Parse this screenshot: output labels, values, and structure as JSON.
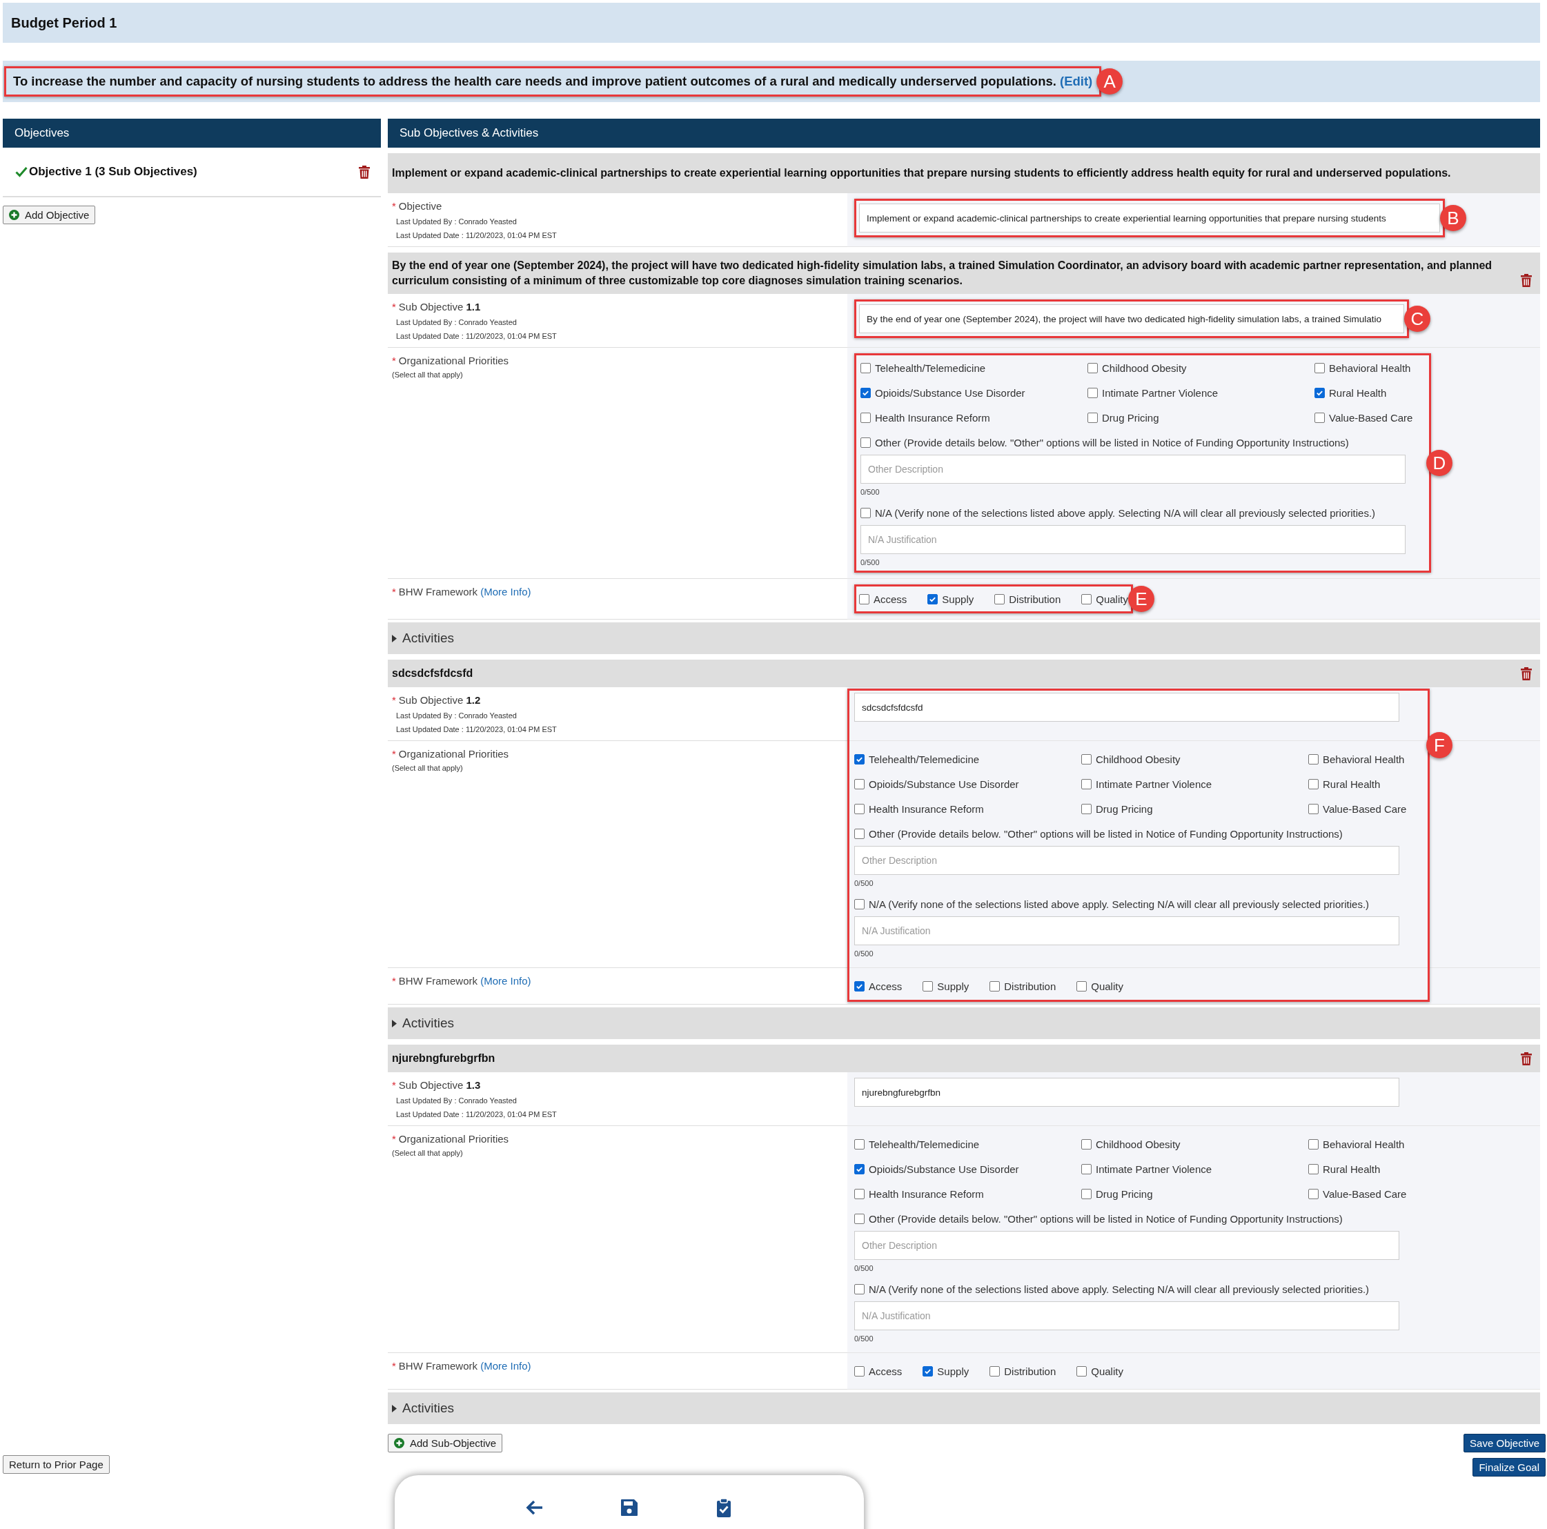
{
  "header": {
    "title": "Budget Period 1"
  },
  "goal": {
    "text": "To increase the number and capacity of nursing students to address the health care needs and improve patient outcomes of a rural and medically underserved populations.",
    "edit_link": "(Edit)",
    "annotation": "A"
  },
  "column_headers": [
    "Objectives",
    "Sub Objectives & Activities"
  ],
  "sidebar": {
    "objectives": [
      {
        "label": "Objective 1 (3 Sub Objectives)",
        "complete": true
      }
    ],
    "add_button": "Add Objective",
    "return_button": "Return to Prior Page"
  },
  "objective": {
    "required_mark": "*",
    "title": "Implement or expand academic-clinical partnerships to create experiential learning opportunities that prepare nursing students to efficiently address health equity for rural and underserved populations.",
    "label": "Objective",
    "updated_by": "Last Updated By : Conrado Yeasted",
    "updated_date": "Last Updated Date : 11/20/2023, 01:04 PM EST",
    "value": "Implement or expand academic-clinical partnerships to create experiential learning opportunities that prepare nursing students",
    "annotation": "B"
  },
  "sub_objectives": [
    {
      "required_marks": [
        "*",
        "*",
        "*"
      ],
      "title": "By the end of year one (September 2024), the project will have two dedicated high-fidelity simulation labs, a trained Simulation Coordinator, an advisory board with academic partner representation, and planned curriculum consisting of a minimum of three customizable top core diagnoses simulation training scenarios.",
      "label": "Sub Objective",
      "number": "1.1",
      "updated_by": "Last Updated By : Conrado Yeasted",
      "updated_date": "Last Updated Date : 11/20/2023, 01:04 PM EST",
      "value": "By the end of year one (September 2024), the project will have two dedicated high-fidelity simulation labs, a trained Simulatio",
      "value_annotation": "C",
      "priorities_label": "Organizational Priorities",
      "priorities_hint": "(Select all that apply)",
      "priorities": [
        {
          "label": "Telehealth/Telemedicine",
          "checked": false
        },
        {
          "label": "Childhood Obesity",
          "checked": false
        },
        {
          "label": "Behavioral Health",
          "checked": false
        },
        {
          "label": "Opioids/Substance Use Disorder",
          "checked": true
        },
        {
          "label": "Intimate Partner Violence",
          "checked": false
        },
        {
          "label": "Rural Health",
          "checked": true
        },
        {
          "label": "Health Insurance Reform",
          "checked": false
        },
        {
          "label": "Drug Pricing",
          "checked": false
        },
        {
          "label": "Value-Based Care",
          "checked": false
        }
      ],
      "other": {
        "label": "Other (Provide details below. \"Other\" options will be listed in Notice of Funding Opportunity Instructions)",
        "checked": false,
        "placeholder": "Other Description",
        "counter": "0/500"
      },
      "na": {
        "label": "N/A (Verify none of the selections listed above apply. Selecting N/A will clear all previously selected priorities.)",
        "checked": false,
        "placeholder": "N/A Justification",
        "counter": "0/500"
      },
      "priorities_annotation": "D",
      "framework_label": "BHW Framework",
      "framework_link": "(More Info)",
      "framework": [
        {
          "label": "Access",
          "checked": false
        },
        {
          "label": "Supply",
          "checked": true
        },
        {
          "label": "Distribution",
          "checked": false
        },
        {
          "label": "Quality",
          "checked": false
        }
      ],
      "framework_annotation": "E",
      "activities": {
        "label": "Activities",
        "expanded": false
      }
    },
    {
      "required_marks": [
        "*",
        "*",
        "*"
      ],
      "title": "sdcsdcfsfdcsfd",
      "label": "Sub Objective",
      "number": "1.2",
      "updated_by": "Last Updated By : Conrado Yeasted",
      "updated_date": "Last Updated Date : 11/20/2023, 01:04 PM EST",
      "value": "sdcsdcfsfdcsfd",
      "section_annotation": "F",
      "priorities_label": "Organizational Priorities",
      "priorities_hint": "(Select all that apply)",
      "priorities": [
        {
          "label": "Telehealth/Telemedicine",
          "checked": true
        },
        {
          "label": "Childhood Obesity",
          "checked": false
        },
        {
          "label": "Behavioral Health",
          "checked": false
        },
        {
          "label": "Opioids/Substance Use Disorder",
          "checked": false
        },
        {
          "label": "Intimate Partner Violence",
          "checked": false
        },
        {
          "label": "Rural Health",
          "checked": false
        },
        {
          "label": "Health Insurance Reform",
          "checked": false
        },
        {
          "label": "Drug Pricing",
          "checked": false
        },
        {
          "label": "Value-Based Care",
          "checked": false
        }
      ],
      "other": {
        "label": "Other (Provide details below. \"Other\" options will be listed in Notice of Funding Opportunity Instructions)",
        "checked": false,
        "placeholder": "Other Description",
        "counter": "0/500"
      },
      "na": {
        "label": "N/A (Verify none of the selections listed above apply. Selecting N/A will clear all previously selected priorities.)",
        "checked": false,
        "placeholder": "N/A Justification",
        "counter": "0/500"
      },
      "framework_label": "BHW Framework",
      "framework_link": "(More Info)",
      "framework": [
        {
          "label": "Access",
          "checked": true
        },
        {
          "label": "Supply",
          "checked": false
        },
        {
          "label": "Distribution",
          "checked": false
        },
        {
          "label": "Quality",
          "checked": false
        }
      ],
      "activities": {
        "label": "Activities",
        "expanded": false
      }
    },
    {
      "required_marks": [
        "*",
        "*",
        "*"
      ],
      "title": "njurebngfurebgrfbn",
      "label": "Sub Objective",
      "number": "1.3",
      "updated_by": "Last Updated By : Conrado Yeasted",
      "updated_date": "Last Updated Date : 11/20/2023, 01:04 PM EST",
      "value": "njurebngfurebgrfbn",
      "priorities_label": "Organizational Priorities",
      "priorities_hint": "(Select all that apply)",
      "priorities": [
        {
          "label": "Telehealth/Telemedicine",
          "checked": false
        },
        {
          "label": "Childhood Obesity",
          "checked": false
        },
        {
          "label": "Behavioral Health",
          "checked": false
        },
        {
          "label": "Opioids/Substance Use Disorder",
          "checked": true
        },
        {
          "label": "Intimate Partner Violence",
          "checked": false
        },
        {
          "label": "Rural Health",
          "checked": false
        },
        {
          "label": "Health Insurance Reform",
          "checked": false
        },
        {
          "label": "Drug Pricing",
          "checked": false
        },
        {
          "label": "Value-Based Care",
          "checked": false
        }
      ],
      "other": {
        "label": "Other (Provide details below. \"Other\" options will be listed in Notice of Funding Opportunity Instructions)",
        "checked": false,
        "placeholder": "Other Description",
        "counter": "0/500"
      },
      "na": {
        "label": "N/A (Verify none of the selections listed above apply. Selecting N/A will clear all previously selected priorities.)",
        "checked": false,
        "placeholder": "N/A Justification",
        "counter": "0/500"
      },
      "framework_label": "BHW Framework",
      "framework_link": "(More Info)",
      "framework": [
        {
          "label": "Access",
          "checked": false
        },
        {
          "label": "Supply",
          "checked": true
        },
        {
          "label": "Distribution",
          "checked": false
        },
        {
          "label": "Quality",
          "checked": false
        }
      ],
      "activities": {
        "label": "Activities",
        "expanded": false
      }
    }
  ],
  "add_sub_button": "Add Sub-Objective",
  "save_button": "Save Objective",
  "finalize_button": "Finalize Goal"
}
